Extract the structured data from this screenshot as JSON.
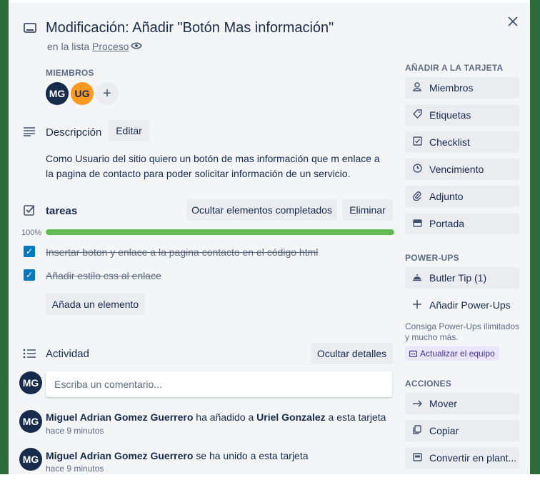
{
  "card": {
    "title": "Modificación: Añadir \"Botón Mas información\"",
    "list_prefix": "en la lista ",
    "list_name": "Proceso"
  },
  "members": {
    "label": "MIEMBROS",
    "avatars": [
      "MG",
      "UG"
    ],
    "add": "+"
  },
  "description": {
    "heading": "Descripción",
    "edit_label": "Editar",
    "text": "Como Usuario del sitio quiero un botón de mas información que m enlace a la pagina de contacto para poder solicitar información de un servicio."
  },
  "checklist": {
    "heading": "tareas",
    "hide_label": "Ocultar elementos completados",
    "delete_label": "Eliminar",
    "progress_text": "100%",
    "progress": 1.0,
    "items": [
      {
        "text": "Insertar boton y enlace a la pagina contacto en el código html",
        "checked": true
      },
      {
        "text": "Añadir estilo css al enlace",
        "checked": true
      }
    ],
    "add_item_label": "Añada un elemento"
  },
  "activity": {
    "heading": "Actividad",
    "hide_details_label": "Ocultar detalles",
    "comment_avatar": "MG",
    "comment_placeholder": "Escriba un comentario...",
    "entries": [
      {
        "avatar": "MG",
        "actor": "Miguel Adrian Gomez Guerrero",
        "action": " ha añadido a ",
        "target": "Uriel Gonzalez",
        "suffix": " a esta tarjeta",
        "time": "hace 9 minutos"
      },
      {
        "avatar": "MG",
        "actor": "Miguel Adrian Gomez Guerrero",
        "action": " se ha unido a esta tarjeta",
        "target": "",
        "suffix": "",
        "time": "hace 9 minutos"
      }
    ]
  },
  "sidebar": {
    "add_to_card_label": "AÑADIR A LA TARJETA",
    "add_to_card": [
      {
        "label": "Miembros",
        "icon": "person-icon"
      },
      {
        "label": "Etiquetas",
        "icon": "tag-icon"
      },
      {
        "label": "Checklist",
        "icon": "checklist-icon"
      },
      {
        "label": "Vencimiento",
        "icon": "clock-icon"
      },
      {
        "label": "Adjunto",
        "icon": "paperclip-icon"
      },
      {
        "label": "Portada",
        "icon": "cover-icon"
      }
    ],
    "powerups_label": "POWER-UPS",
    "powerups": [
      {
        "label": "Butler Tip (1)",
        "icon": "butler-bell-icon"
      },
      {
        "label": "Añadir Power-Ups",
        "icon": "plus-icon"
      }
    ],
    "upsell_text": "Consiga Power-Ups ilimitados y mucho más.",
    "upgrade_label": "Actualizar el equipo",
    "actions_label": "ACCIONES",
    "actions": [
      {
        "label": "Mover",
        "icon": "arrow-right-icon"
      },
      {
        "label": "Copiar",
        "icon": "copy-icon"
      },
      {
        "label": "Convertir en plant...",
        "icon": "template-icon"
      }
    ]
  },
  "colors": {
    "card_bg": "#f4f5f7",
    "button_bg": "#ebecf0",
    "progress_green": "#61bd4f",
    "checkbox_blue": "#0079bf",
    "avatar_dark": "#172b4d",
    "avatar_orange": "#ff991f",
    "board_green": "#2e6b3a"
  }
}
